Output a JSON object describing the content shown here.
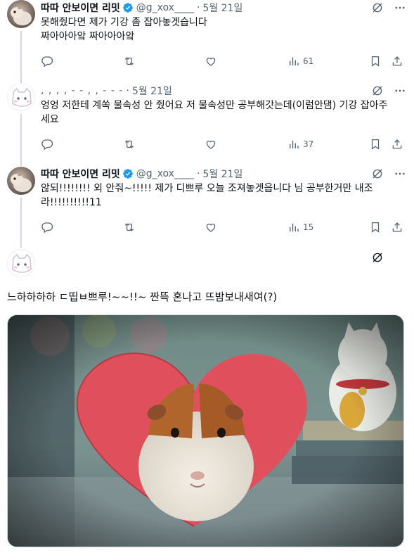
{
  "tweets": [
    {
      "author": "따따  안보이면 리밋",
      "handle": "@g_xox____",
      "separator": "·",
      "date": "5월 21일",
      "text_lines": [
        "못해줬다면 제가 기강 좀 잡아놓겟습니다",
        "짜아아아앜 짜아아아앜"
      ],
      "views": "61"
    },
    {
      "author_redacted": ",  ,    ,  ,  - -   ,  ,  - - -",
      "separator": "·",
      "date": "5월 21일",
      "text_lines": [
        "엉엉 저한테 계쏙 물속성 안 줬어요 저 물속성만 공부해갓는데(이럼안댐) 기강 잡아주",
        "세요"
      ],
      "views": "37"
    },
    {
      "author": "따따  안보이면 리밋",
      "handle": "@g_xox____",
      "separator": "·",
      "date": "5월 21일",
      "text_lines": [
        "않되!!!!!!!! 외 안줘~!!!!! 제가 디쁘루 오늘 조져놓겟읍니다      님 공부한거만 내조",
        "라!!!!!!!!!!11"
      ],
      "views": "15"
    }
  ],
  "main_post": {
    "text": "느하하하하 ㄷ띱ㅂ쁘루!~~!!~ 짠뜩 혼나고 뜨밤보내새여(?)"
  },
  "icons": {
    "reply": "reply-icon",
    "retweet": "retweet-icon",
    "like": "heart-icon",
    "views": "views-icon",
    "bookmark": "bookmark-icon",
    "share": "share-icon",
    "grok": "grok-icon",
    "more": "more-icon",
    "verified": "verified-badge-icon"
  },
  "colors": {
    "verified_blue": "#1d9bf0",
    "secondary_text": "#536471",
    "thread_line": "#cfd9de"
  }
}
